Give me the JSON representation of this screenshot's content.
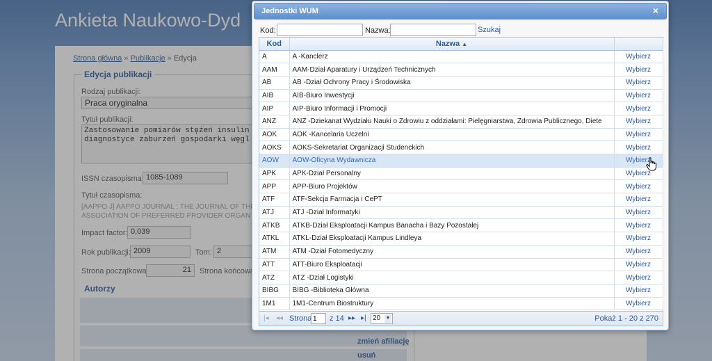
{
  "app": {
    "title": "Ankieta Naukowo-Dyd"
  },
  "breadcrumb": {
    "home": "Strona główna",
    "publications": "Publikacje",
    "current": "Edycja",
    "separator": "»"
  },
  "form": {
    "legend": "Edycja publikacji",
    "type_label": "Rodzaj publikacji:",
    "type_value": "Praca oryginalna",
    "title_label": "Tytuł publikacji:",
    "title_line1": "Zastosowanie pomiarów stężeń insulin",
    "title_line2": "diagnostyce zaburzeń gospodarki węgl",
    "issn_label": "ISSN czasopisma:",
    "issn_value": "1085-1089",
    "journal_label": "Tytuł czasopisma:",
    "journal_line1": "[AAPPO J] AAPPO JOURNAL : THE JOURNAL OF THE",
    "journal_line2": "ASSOCIATION OF PREFERRED PROVIDER ORGAN",
    "if_label": "Impact factor:",
    "if_value": "0,039",
    "year_label": "Rok publikacji:",
    "year_value": "2009",
    "volume_label": "Tom:",
    "volume_value": "2",
    "start_page_label": "Strona początkowa:",
    "start_page_value": "21",
    "end_page_label": "Strona końcowa",
    "authors_heading": "Autorzy",
    "change_affiliation": "zmień afiliację",
    "remove": "usuń"
  },
  "dialog": {
    "title": "Jednostki WUM",
    "close_glyph": "×",
    "code_label": "Kod:",
    "name_label": "Nazwa:",
    "code_value": "",
    "name_value": "",
    "search_label": "Szukaj",
    "columns": {
      "code": "Kod",
      "name": "Nazwa",
      "sort_glyph": "▲"
    },
    "action_label": "Wybierz",
    "rows": [
      {
        "code": "A",
        "name": "A -Kanclerz"
      },
      {
        "code": "AAM",
        "name": "AAM-Dział Aparatury i Urządzeń Technicznych"
      },
      {
        "code": "AB",
        "name": "AB -Dział Ochrony Pracy i Środowiska"
      },
      {
        "code": "AIB",
        "name": "AIB-Biuro Inwestycji"
      },
      {
        "code": "AIP",
        "name": "AIP-Biuro Informacji i Promocji"
      },
      {
        "code": "ANZ",
        "name": "ANZ -Dziekanat Wydziału Nauki o Zdrowiu z oddziałami: Pielęgniarstwa, Zdrowia Publicznego, Diete"
      },
      {
        "code": "AOK",
        "name": "AOK -Kancelaria Uczelni"
      },
      {
        "code": "AOKS",
        "name": "AOKS-Sekretariat Organizacji Studenckich"
      },
      {
        "code": "AOW",
        "name": "AOW-Oficyna Wydawnicza"
      },
      {
        "code": "APK",
        "name": "APK-Dział Personalny"
      },
      {
        "code": "APP",
        "name": "APP-Biuro Projektów"
      },
      {
        "code": "ATF",
        "name": "ATF-Sekcja Farmacja i CePT"
      },
      {
        "code": "ATJ",
        "name": "ATJ -Dział Informatyki"
      },
      {
        "code": "ATKB",
        "name": "ATKB-Dział Eksploatacji Kampus Banacha i Bazy Pozostałej"
      },
      {
        "code": "ATKL",
        "name": "ATKL-Dział Eksploatacji Kampus Lindleya"
      },
      {
        "code": "ATM",
        "name": "ATM -Dział Fotomedyczny"
      },
      {
        "code": "ATT",
        "name": "ATT-Biuro Eksploatacji"
      },
      {
        "code": "ATZ",
        "name": "ATZ -Dział Logistyki"
      },
      {
        "code": "BIBG",
        "name": "BIBG -Biblioteka Główna"
      },
      {
        "code": "1M1",
        "name": "1M1-Centrum Biostruktury"
      }
    ],
    "hover_row": 8,
    "pager": {
      "first": "|◂",
      "prev": "◂◂",
      "page_label": "Strona",
      "page_value": "1",
      "of_label": "z 14",
      "next": "▸▸",
      "last": "▸|",
      "page_size": "20",
      "info": "Pokaż 1 - 20 z 270"
    }
  }
}
